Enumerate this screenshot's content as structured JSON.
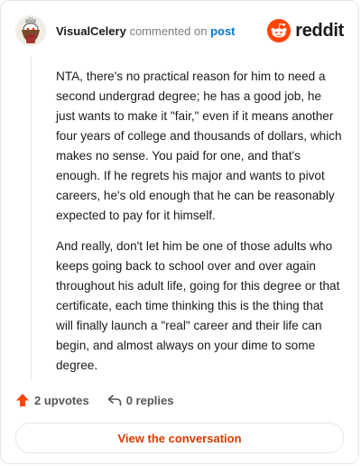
{
  "header": {
    "username": "VisualCelery",
    "action_text": "commented on",
    "post_link": "post",
    "logo_text": "reddit"
  },
  "comment": {
    "paragraphs": [
      "NTA, there's no practical reason for him to need a second undergrad degree; he has a good job, he just wants to make it \"fair,\" even if it means another four years of college and thousands of dollars, which makes no sense. You paid for one, and that's enough. If he regrets his major and wants to pivot careers, he's old enough that he can be reasonably expected to pay for it himself.",
      "And really, don't let him be one of those adults who keeps going back to school over and over again throughout his adult life, going for this degree or that certificate, each time thinking this is the thing that will finally launch a \"real\" career and their life can begin, and almost always on your dime to some degree."
    ]
  },
  "actions": {
    "upvotes_label": "2 upvotes",
    "replies_label": "0 replies"
  },
  "cta": {
    "label": "View the conversation"
  },
  "colors": {
    "accent": "#d93a00",
    "link": "#0079d3",
    "reddit_orange": "#ff4500"
  },
  "icons": {
    "upvote": "upvote-arrow-icon",
    "reply": "reply-arrow-icon",
    "logo": "reddit-logo-icon",
    "avatar": "snoo-avatar-icon"
  }
}
